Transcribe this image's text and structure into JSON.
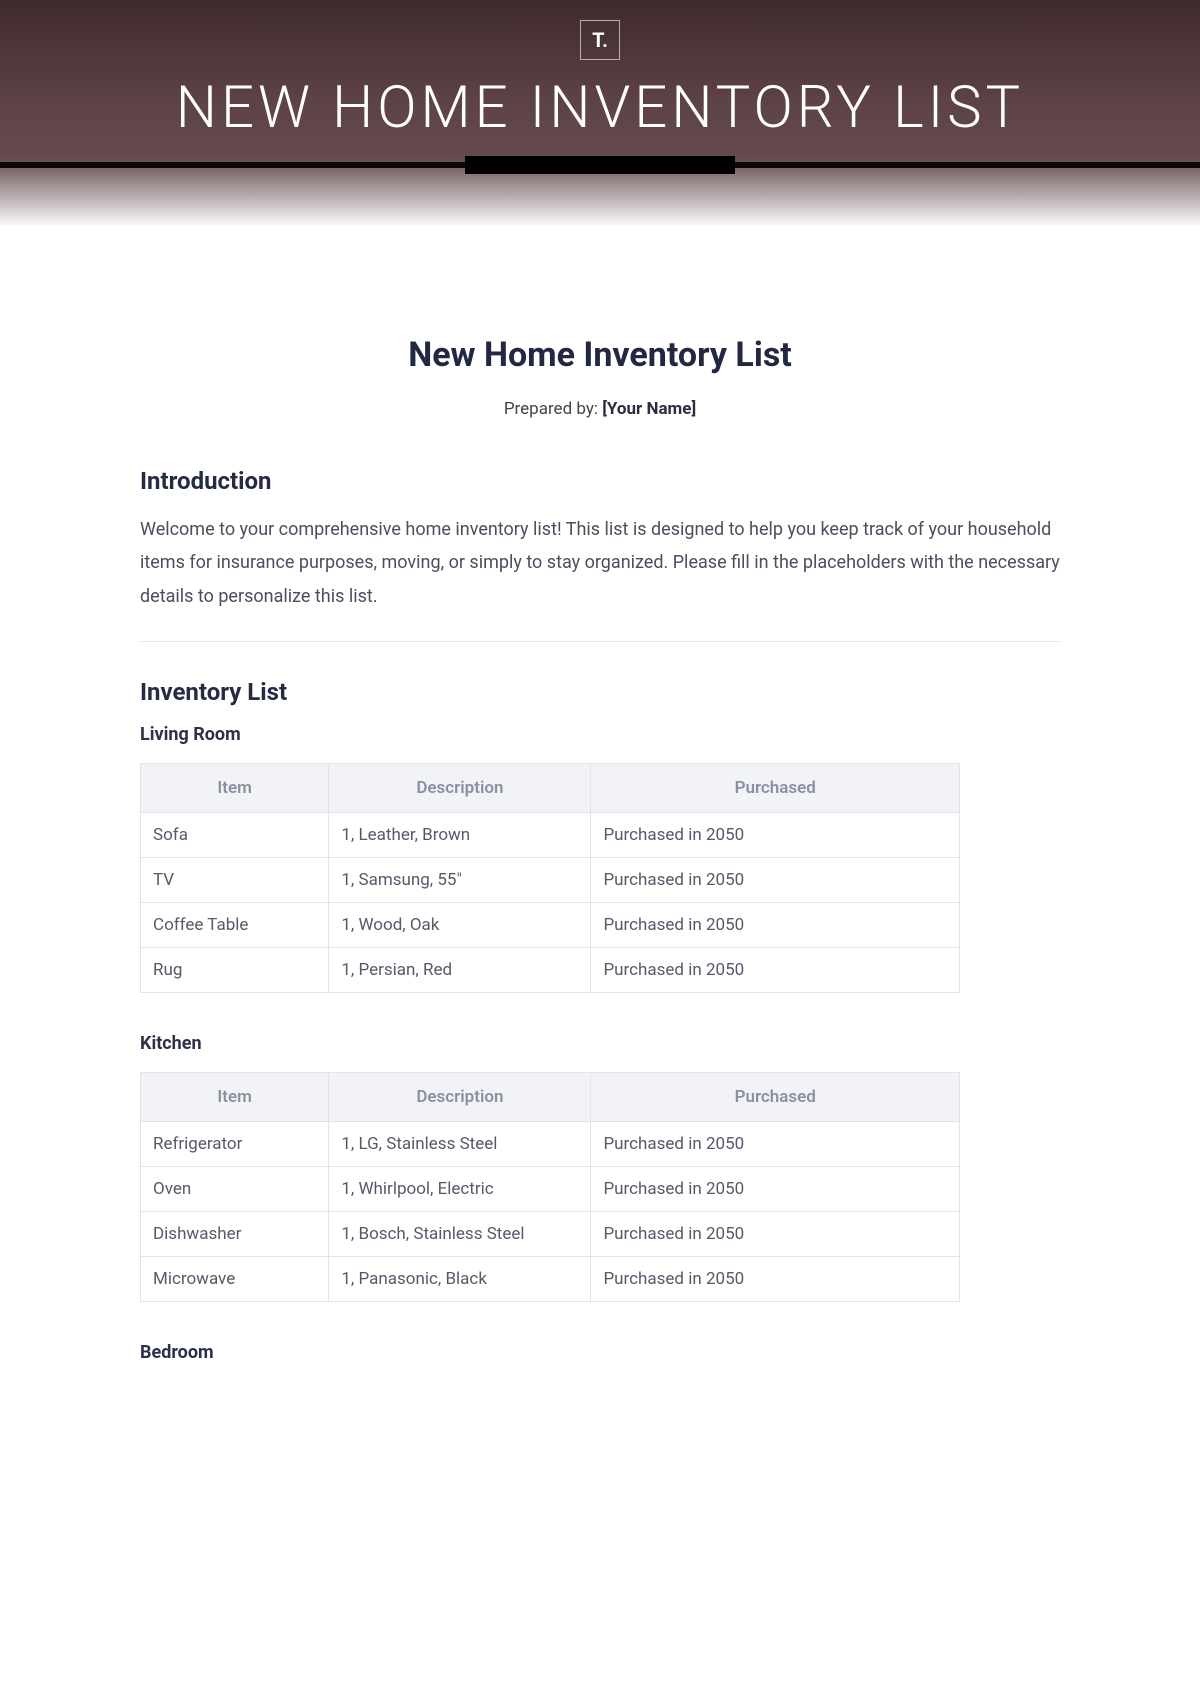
{
  "banner": {
    "logo": "T.",
    "title": "NEW HOME INVENTORY LIST"
  },
  "doc": {
    "title": "New Home Inventory List",
    "prepared_prefix": "Prepared by: ",
    "prepared_name": "[Your Name]"
  },
  "intro": {
    "heading": "Introduction",
    "body": "Welcome to your comprehensive home inventory list! This list is designed to help you keep track of your household items for insurance purposes, moving, or simply to stay organized. Please fill in the placeholders with the necessary details to personalize this list."
  },
  "inventory": {
    "heading": "Inventory List",
    "columns": {
      "c0": "Item",
      "c1": "Description",
      "c2": "Purchased"
    },
    "rooms": [
      {
        "name": "Living Room",
        "rows": [
          {
            "item": "Sofa",
            "desc": "1, Leather, Brown",
            "purchased": "Purchased in 2050"
          },
          {
            "item": "TV",
            "desc": "1, Samsung, 55\"",
            "purchased": "Purchased in 2050"
          },
          {
            "item": "Coffee Table",
            "desc": "1, Wood, Oak",
            "purchased": "Purchased in 2050"
          },
          {
            "item": "Rug",
            "desc": "1, Persian, Red",
            "purchased": "Purchased in 2050"
          }
        ]
      },
      {
        "name": "Kitchen",
        "rows": [
          {
            "item": "Refrigerator",
            "desc": "1, LG, Stainless Steel",
            "purchased": "Purchased in 2050"
          },
          {
            "item": "Oven",
            "desc": "1, Whirlpool, Electric",
            "purchased": "Purchased in 2050"
          },
          {
            "item": "Dishwasher",
            "desc": "1, Bosch, Stainless Steel",
            "purchased": "Purchased in 2050"
          },
          {
            "item": "Microwave",
            "desc": "1, Panasonic, Black",
            "purchased": "Purchased in 2050"
          }
        ]
      },
      {
        "name": "Bedroom",
        "rows": []
      }
    ]
  }
}
